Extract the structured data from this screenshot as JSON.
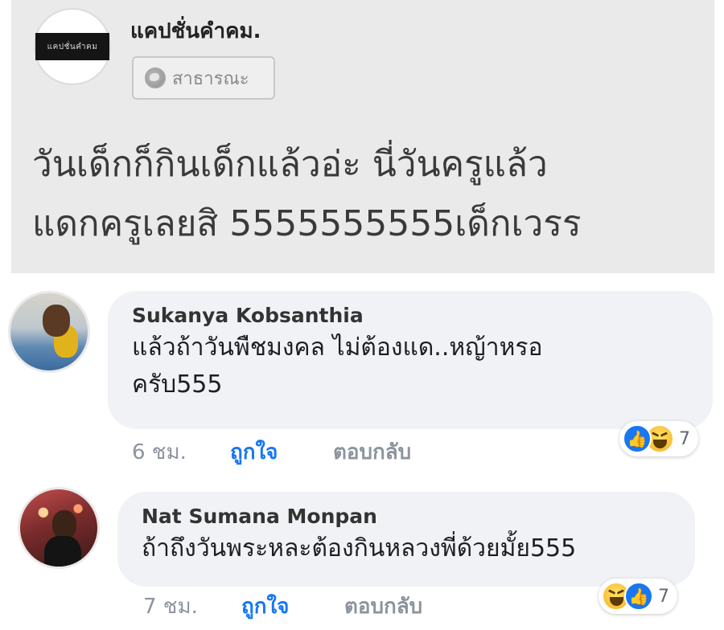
{
  "post": {
    "page_name": "แคปชั่นคำคม.",
    "avatar_label": "แคปชั่นคำคม",
    "privacy_label": "สาธารณะ",
    "text_line1": "วันเด็กก็กินเด็กแล้วอ่ะ นี่วันครูแล้ว",
    "text_line2": "แดกครูเลยสิ 5555555555เด็กเวรร"
  },
  "comments": [
    {
      "author": "Sukanya Kobsanthia",
      "text_line1": "แล้วถ้าวันพืชมงคล ไม่ต้องแด..หญ้าหรอ",
      "text_line2": "ครับ555",
      "time": "6 ชม.",
      "like_label": "ถูกใจ",
      "reply_label": "ตอบกลับ",
      "reaction_icons": [
        "like-icon",
        "haha-icon"
      ],
      "reaction_count": "7"
    },
    {
      "author": "Nat Sumana Monpan",
      "text_line1": "ถ้าถึงวันพระหละต้องกินหลวงพี่ด้วยมั้ย555",
      "time": "7 ชม.",
      "like_label": "ถูกใจ",
      "reply_label": "ตอบกลับ",
      "reaction_icons": [
        "haha-icon",
        "like-icon"
      ],
      "reaction_count": "7"
    }
  ],
  "colors": {
    "like_blue": "#1877f2",
    "bubble_bg": "#f0f2f5",
    "post_bg": "#eaeaea",
    "meta_gray": "#8d949e"
  }
}
